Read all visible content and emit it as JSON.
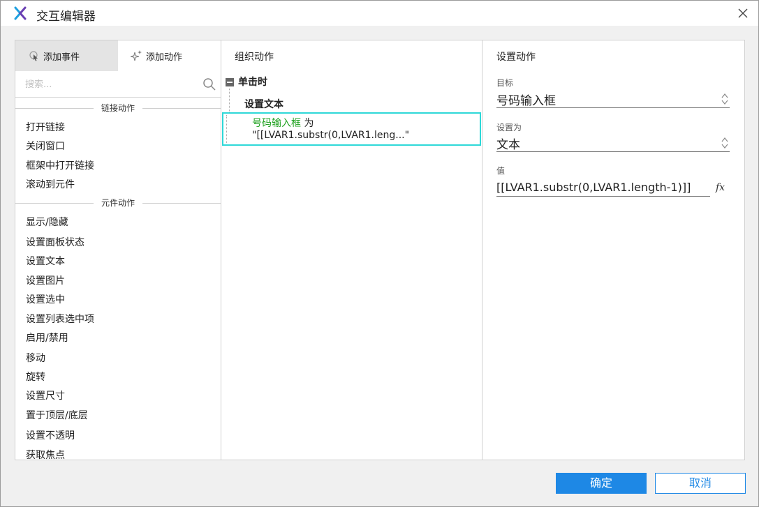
{
  "window": {
    "title": "交互编辑器"
  },
  "left_panel": {
    "tabs": [
      {
        "label": "添加事件",
        "active": true
      },
      {
        "label": "添加动作",
        "active": false
      }
    ],
    "search": {
      "placeholder": "搜索...",
      "value": ""
    },
    "sections": [
      {
        "title": "链接动作",
        "items": [
          "打开链接",
          "关闭窗口",
          "框架中打开链接",
          "滚动到元件"
        ]
      },
      {
        "title": "元件动作",
        "items": [
          "显示/隐藏",
          "设置面板状态",
          "设置文本",
          "设置图片",
          "设置选中",
          "设置列表选中项",
          "启用/禁用",
          "移动",
          "旋转",
          "设置尺寸",
          "置于顶层/底层",
          "设置不透明",
          "获取焦点"
        ]
      }
    ]
  },
  "middle_panel": {
    "header": "组织动作",
    "event": "单击时",
    "action": "设置文本",
    "selected": {
      "target": "号码输入框",
      "connector": " 为",
      "value_preview": "\"[[LVAR1.substr(0,LVAR1.leng...\""
    }
  },
  "right_panel": {
    "header": "设置动作",
    "target_label": "目标",
    "target_value": "号码输入框",
    "set_as_label": "设置为",
    "set_as_value": "文本",
    "value_label": "值",
    "value": "[[LVAR1.substr(0,LVAR1.length-1)]]",
    "fx_label": "fx"
  },
  "footer": {
    "ok_label": "确定",
    "cancel_label": "取消"
  },
  "colors": {
    "accent": "#1e88e5",
    "selection_border": "#2ed8d8",
    "target_green": "#1fa11f"
  }
}
